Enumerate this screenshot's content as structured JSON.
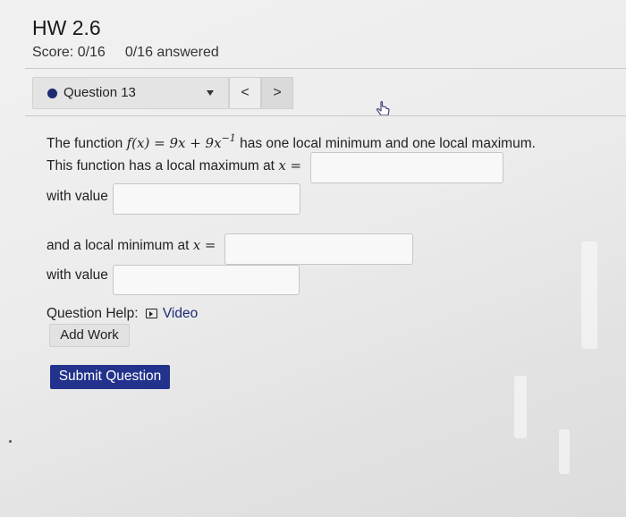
{
  "header": {
    "title": "HW 2.6",
    "score": "Score: 0/16",
    "answered": "0/16 answered"
  },
  "question_nav": {
    "label": "Question 13",
    "prev": "<",
    "next": ">"
  },
  "question": {
    "line1_prefix": "The function",
    "function_lhs": "f(x)",
    "function_eq": " = 9x + 9x",
    "function_exp": "−1",
    "line1_suffix": "has one local minimum and one local maximum.",
    "local_max_prompt": "This function has a local maximum at",
    "x_eq": "x =",
    "with_value_1": "with value",
    "local_min_prompt": "and a local minimum at",
    "with_value_2": "with value",
    "inputs": [
      "",
      "",
      "",
      ""
    ]
  },
  "help": {
    "label": "Question Help:",
    "video": "Video",
    "add_work": "Add Work"
  },
  "submit_label": "Submit Question",
  "colors": {
    "accent": "#23328c",
    "dot": "#1c2a72"
  },
  "icons": [
    "cursor-pointer-icon",
    "video-icon"
  ]
}
